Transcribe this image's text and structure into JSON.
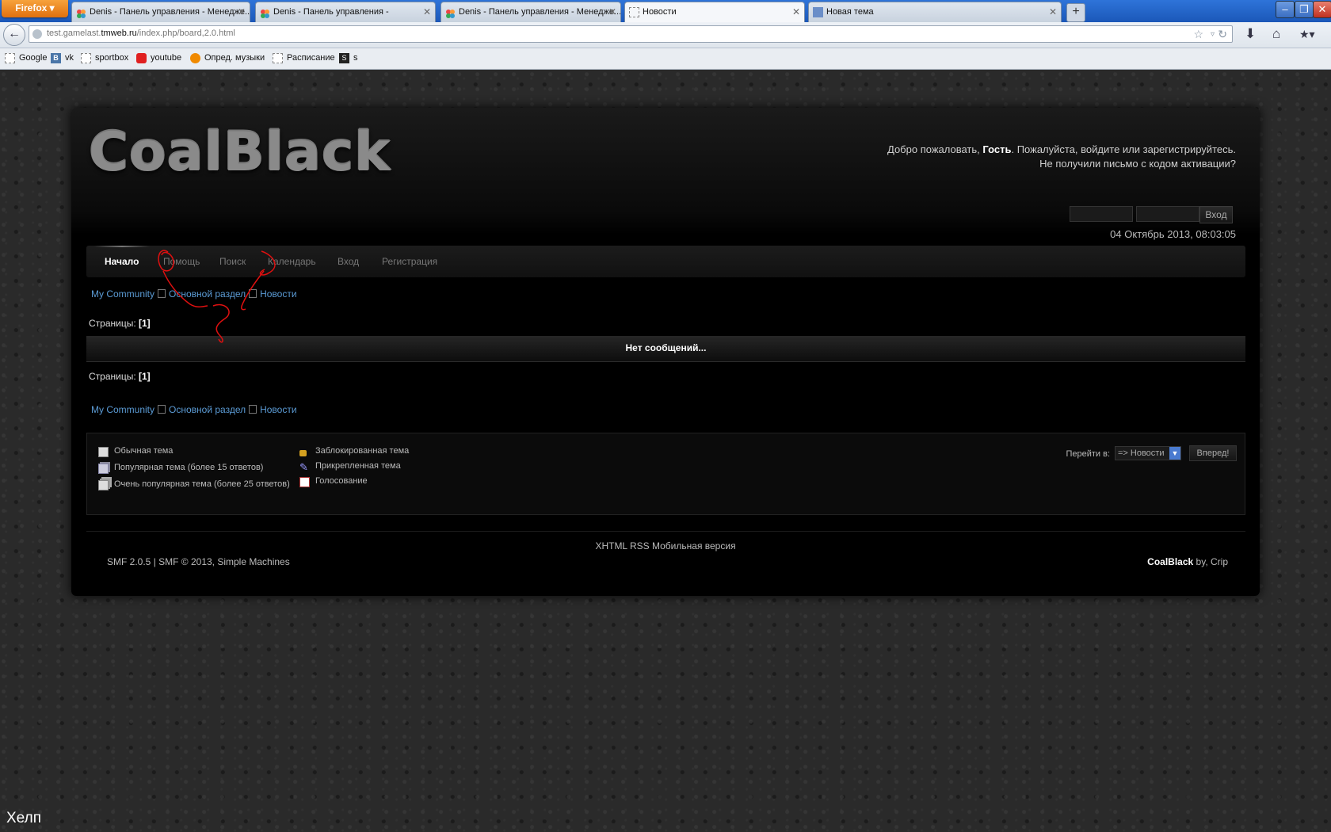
{
  "browser": {
    "app_button": "Firefox",
    "tabs": [
      {
        "label": "Denis - Панель управления - Менедже...",
        "active": false
      },
      {
        "label": "Denis - Панель управления -",
        "active": false
      },
      {
        "label": "Denis - Панель управления - Менедже...",
        "active": false
      },
      {
        "label": "Новости",
        "active": true
      },
      {
        "label": "Новая тема",
        "active": false
      }
    ],
    "url_prefix": "test.gamelast.",
    "url_domain": "tmweb.ru",
    "url_path": "/index.php/board,2.0.html",
    "bookmarks": [
      "Google",
      "vk",
      "sportbox",
      "youtube",
      "Опред. музыки",
      "Расписание",
      "s"
    ]
  },
  "header": {
    "logo": "CoalBlack",
    "welcome_prefix": "Добро пожаловать, ",
    "welcome_user": "Гость",
    "welcome_suffix": ". Пожалуйста, войдите или зарегистрируйтесь.",
    "activation_link": "Не получили письмо с кодом активации?",
    "login_button": "Вход",
    "datetime": "04 Октябрь 2013, 08:03:05"
  },
  "menu": {
    "items": [
      "Начало",
      "Помощь",
      "Поиск",
      "Календарь",
      "Вход",
      "Регистрация"
    ],
    "active": "Начало"
  },
  "breadcrumb": [
    "My Community",
    "Основной раздел",
    "Новости"
  ],
  "pages": {
    "label": "Страницы:",
    "current": "[1]"
  },
  "no_messages": "Нет сообщений...",
  "legend": {
    "left": [
      "Обычная тема",
      "Популярная тема (более 15 ответов)",
      "Очень популярная тема (более 25 ответов)"
    ],
    "right": [
      "Заблокированная тема",
      "Прикрепленная тема",
      "Голосование"
    ]
  },
  "jump": {
    "label": "Перейти в:",
    "selected": "=> Новости",
    "button": "Вперед!"
  },
  "footer": {
    "links": "XHTML RSS Мобильная версия",
    "copyright": "SMF 2.0.5 | SMF © 2013, Simple Machines",
    "theme_name": "CoalBlack",
    "theme_by": " by, Crip"
  },
  "overlay_text": "Хелп",
  "colors": {
    "link": "#5b9bd5",
    "annotation": "#e01010",
    "background": "#000000"
  }
}
